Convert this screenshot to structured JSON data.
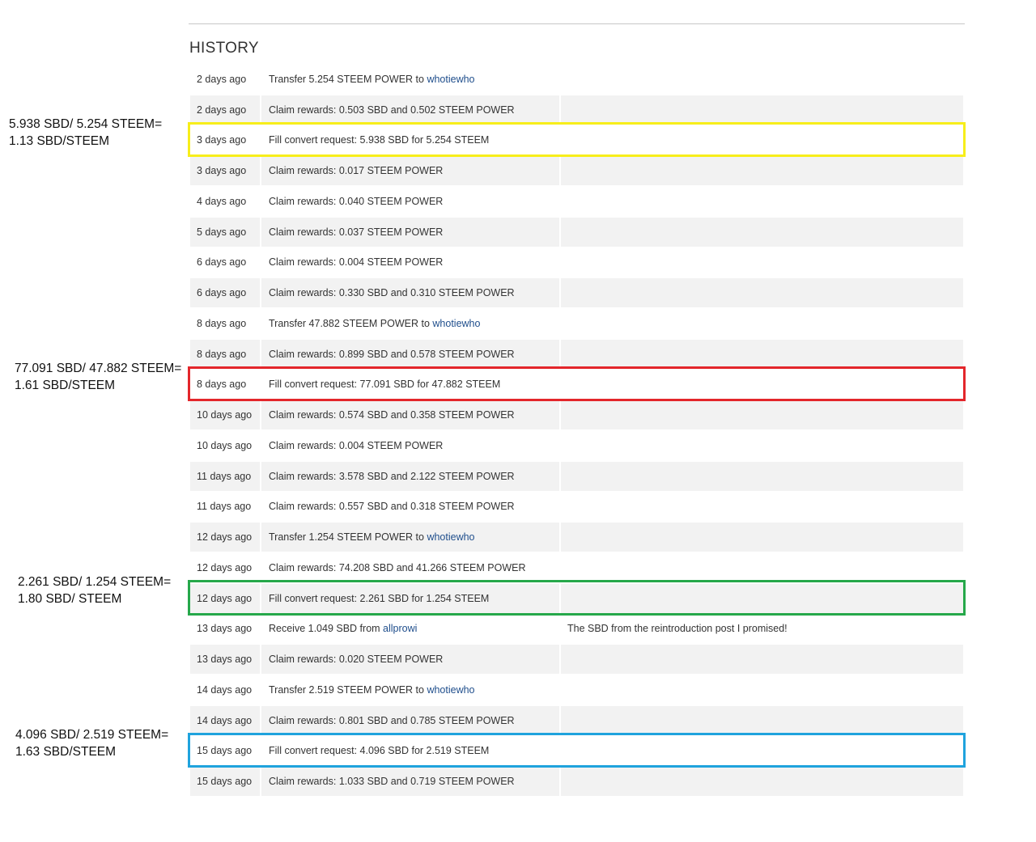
{
  "history": {
    "title": "HISTORY",
    "rows": [
      {
        "date": "2 days ago",
        "desc": "Transfer 5.254 STEEM POWER to ",
        "link": "whotiewho",
        "memo": ""
      },
      {
        "date": "2 days ago",
        "desc": "Claim rewards: 0.503 SBD and 0.502 STEEM POWER",
        "link": "",
        "memo": ""
      },
      {
        "date": "3 days ago",
        "desc": "Fill convert request: 5.938 SBD for 5.254 STEEM",
        "link": "",
        "memo": ""
      },
      {
        "date": "3 days ago",
        "desc": "Claim rewards: 0.017 STEEM POWER",
        "link": "",
        "memo": ""
      },
      {
        "date": "4 days ago",
        "desc": "Claim rewards: 0.040 STEEM POWER",
        "link": "",
        "memo": ""
      },
      {
        "date": "5 days ago",
        "desc": "Claim rewards: 0.037 STEEM POWER",
        "link": "",
        "memo": ""
      },
      {
        "date": "6 days ago",
        "desc": "Claim rewards: 0.004 STEEM POWER",
        "link": "",
        "memo": ""
      },
      {
        "date": "6 days ago",
        "desc": "Claim rewards: 0.330 SBD and 0.310 STEEM POWER",
        "link": "",
        "memo": ""
      },
      {
        "date": "8 days ago",
        "desc": "Transfer 47.882 STEEM POWER to ",
        "link": "whotiewho",
        "memo": ""
      },
      {
        "date": "8 days ago",
        "desc": "Claim rewards: 0.899 SBD and 0.578 STEEM POWER",
        "link": "",
        "memo": ""
      },
      {
        "date": "8 days ago",
        "desc": "Fill convert request: 77.091 SBD for 47.882 STEEM",
        "link": "",
        "memo": ""
      },
      {
        "date": "10 days ago",
        "desc": "Claim rewards: 0.574 SBD and 0.358 STEEM POWER",
        "link": "",
        "memo": ""
      },
      {
        "date": "10 days ago",
        "desc": "Claim rewards: 0.004 STEEM POWER",
        "link": "",
        "memo": ""
      },
      {
        "date": "11 days ago",
        "desc": "Claim rewards: 3.578 SBD and 2.122 STEEM POWER",
        "link": "",
        "memo": ""
      },
      {
        "date": "11 days ago",
        "desc": "Claim rewards: 0.557 SBD and 0.318 STEEM POWER",
        "link": "",
        "memo": ""
      },
      {
        "date": "12 days ago",
        "desc": "Transfer 1.254 STEEM POWER to ",
        "link": "whotiewho",
        "memo": ""
      },
      {
        "date": "12 days ago",
        "desc": "Claim rewards: 74.208 SBD and 41.266 STEEM POWER",
        "link": "",
        "memo": ""
      },
      {
        "date": "12 days ago",
        "desc": "Fill convert request: 2.261 SBD for 1.254 STEEM",
        "link": "",
        "memo": ""
      },
      {
        "date": "13 days ago",
        "desc": "Receive 1.049 SBD from ",
        "link": "allprowi",
        "memo": "The SBD from the reintroduction post I promised!"
      },
      {
        "date": "13 days ago",
        "desc": "Claim rewards: 0.020 STEEM POWER",
        "link": "",
        "memo": ""
      },
      {
        "date": "14 days ago",
        "desc": "Transfer 2.519 STEEM POWER to ",
        "link": "whotiewho",
        "memo": ""
      },
      {
        "date": "14 days ago",
        "desc": "Claim rewards: 0.801 SBD and 0.785 STEEM POWER",
        "link": "",
        "memo": ""
      },
      {
        "date": "15 days ago",
        "desc": "Fill convert request: 4.096 SBD for 2.519 STEEM",
        "link": "",
        "memo": ""
      },
      {
        "date": "15 days ago",
        "desc": "Claim rewards: 1.033 SBD and 0.719 STEEM POWER",
        "link": "",
        "memo": ""
      }
    ]
  },
  "highlights": [
    {
      "row": 2,
      "color": "#f7ee1a"
    },
    {
      "row": 10,
      "color": "#e3262b"
    },
    {
      "row": 17,
      "color": "#26a84a"
    },
    {
      "row": 22,
      "color": "#1fa3dd"
    }
  ],
  "annotations": [
    {
      "line1": "5.938 SBD/ 5.254 STEEM=",
      "line2": "1.13 SBD/STEEM"
    },
    {
      "line1": "77.091 SBD/ 47.882 STEEM=",
      "line2": "1.61 SBD/STEEM"
    },
    {
      "line1": "2.261 SBD/ 1.254 STEEM=",
      "line2": "1.80 SBD/ STEEM"
    },
    {
      "line1": "4.096 SBD/ 2.519 STEEM=",
      "line2": "1.63 SBD/STEEM"
    }
  ]
}
